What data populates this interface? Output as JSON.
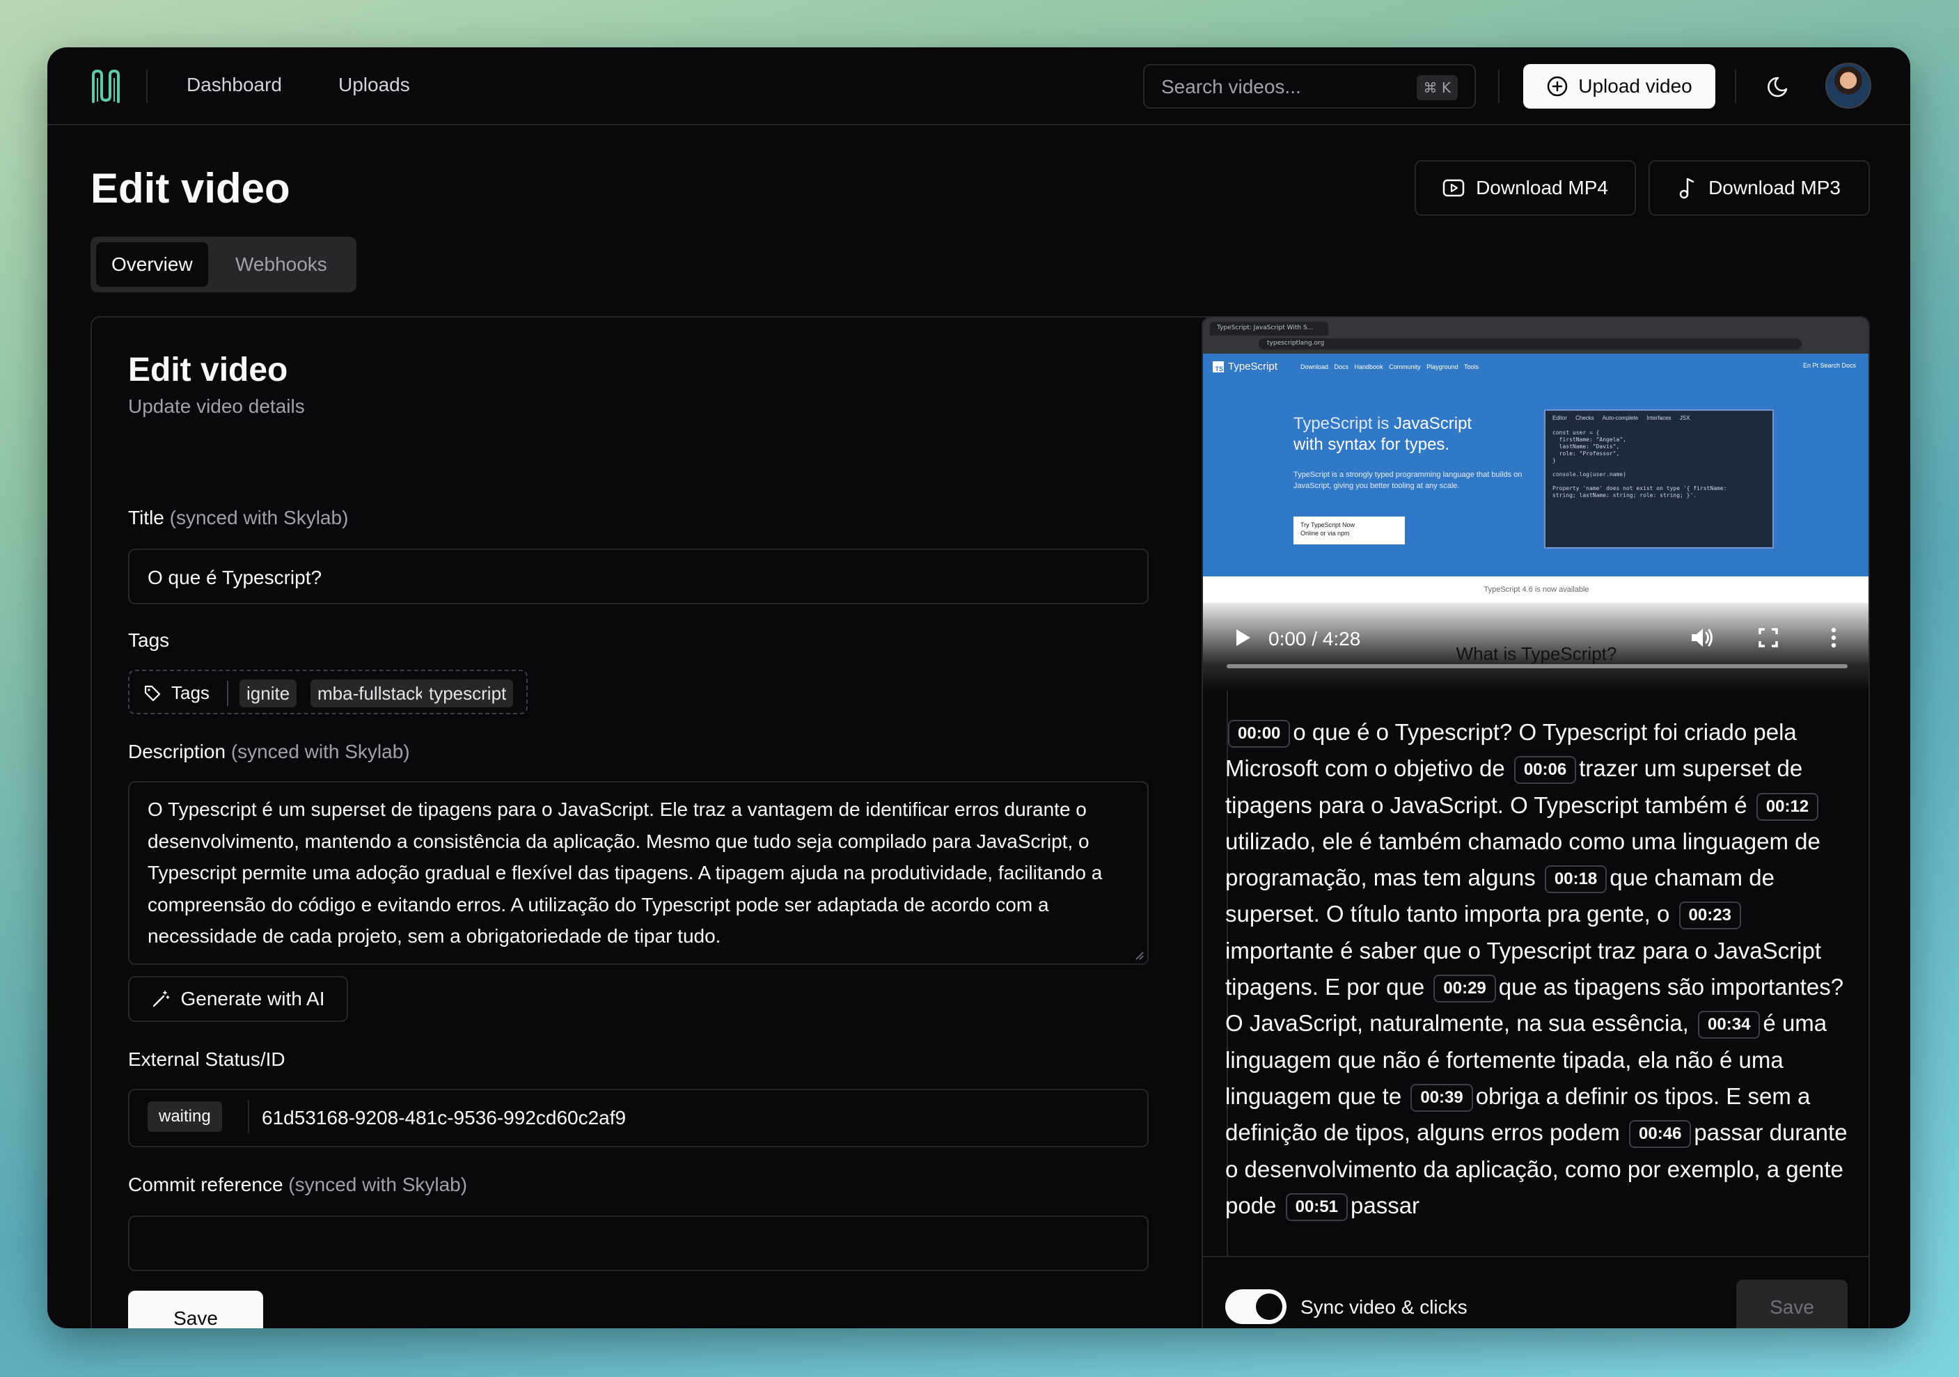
{
  "header": {
    "nav": [
      "Dashboard",
      "Uploads"
    ],
    "search_placeholder": "Search videos...",
    "search_shortcut": "⌘ K",
    "upload_label": "Upload video"
  },
  "page": {
    "title": "Edit video",
    "download_mp4": "Download MP4",
    "download_mp3": "Download MP3",
    "tabs": [
      {
        "label": "Overview",
        "active": true
      },
      {
        "label": "Webhooks",
        "active": false
      }
    ]
  },
  "form": {
    "title": "Edit video",
    "subtitle": "Update video details",
    "title_label": "Title",
    "title_hint": "(synced with Skylab)",
    "title_value": "O que é Typescript?",
    "tags_label": "Tags",
    "tags_button": "Tags",
    "tags": [
      "ignite",
      "mba-fullstack",
      "typescript"
    ],
    "description_label": "Description",
    "description_hint": "(synced with Skylab)",
    "description_value": "O Typescript é um superset de tipagens para o JavaScript. Ele traz a vantagem de identificar erros durante o desenvolvimento, mantendo a consistência da aplicação. Mesmo que tudo seja compilado para JavaScript, o Typescript permite uma adoção gradual e flexível das tipagens. A tipagem ajuda na produtividade, facilitando a compreensão do código e evitando erros. A utilização do Typescript pode ser adaptada de acordo com a necessidade de cada projeto, sem a obrigatoriedade de tipar tudo.",
    "generate_ai": "Generate with AI",
    "external_label": "External Status/ID",
    "external_status": "waiting",
    "external_id": "61d53168-9208-481c-9536-992cd60c2af9",
    "commit_label": "Commit reference",
    "commit_hint": "(synced with Skylab)",
    "commit_value": "",
    "save": "Save"
  },
  "video": {
    "time": "0:00 / 4:28",
    "caption": "What is TypeScript?",
    "progress": 0.0,
    "frame": {
      "tab_title": "TypeScript: JavaScript With S...",
      "url": "typescriptlang.org",
      "logo": "TypeScript",
      "nav": "Download Docs Handbook Community Playground Tools",
      "nav_right": "En Pt   Search Docs",
      "headline_1a": "TypeScript is ",
      "headline_1b": "JavaScript",
      "headline_2": "with syntax for types.",
      "body": "TypeScript is a strongly typed programming language that builds on JavaScript, giving you better tooling at any scale.",
      "cta_1": "Try TypeScript Now",
      "cta_2": "Online or via npm",
      "code_tabs": "Editor Checks  Auto-complete  Interfaces  JSX",
      "code": "const user = {\n  firstName: \"Angela\",\n  lastName: \"Davis\",\n  role: \"Professor\",\n}\n\nconsole.log(user.name)\n\nProperty 'name' does not exist on type '{ firstName:\nstring; lastName: string; role: string; }'.",
      "footer": "TypeScript 4.6 is now available"
    }
  },
  "transcript": [
    {
      "time": "00:00",
      "text": "o que é o Typescript? O Typescript foi criado pela Microsoft com o objetivo de"
    },
    {
      "time": "00:06",
      "text": "trazer um superset de tipagens para o JavaScript. O Typescript também é"
    },
    {
      "time": "00:12",
      "text": "utilizado, ele é também chamado como uma linguagem de programação, mas tem alguns"
    },
    {
      "time": "00:18",
      "text": "que chamam de superset. O título tanto importa pra gente, o"
    },
    {
      "time": "00:23",
      "text": "importante é saber que o Typescript traz para o JavaScript tipagens. E por que"
    },
    {
      "time": "00:29",
      "text": "que as tipagens são importantes? O JavaScript, naturalmente, na sua essência,"
    },
    {
      "time": "00:34",
      "text": "é uma linguagem que não é fortemente tipada, ela não é uma linguagem que te"
    },
    {
      "time": "00:39",
      "text": "obriga a definir os tipos. E sem a definição de tipos, alguns erros podem"
    },
    {
      "time": "00:46",
      "text": "passar durante o desenvolvimento da aplicação, como por exemplo, a gente pode"
    },
    {
      "time": "00:51",
      "text": "passar"
    }
  ],
  "footer": {
    "sync_label": "Sync video & clicks",
    "sync_on": true,
    "save": "Save"
  },
  "colors": {
    "background": "#09090b",
    "border": "#27272a",
    "foreground": "#fafafa",
    "muted": "#a1a1aa",
    "logo_accent": "#5fc9a8"
  }
}
